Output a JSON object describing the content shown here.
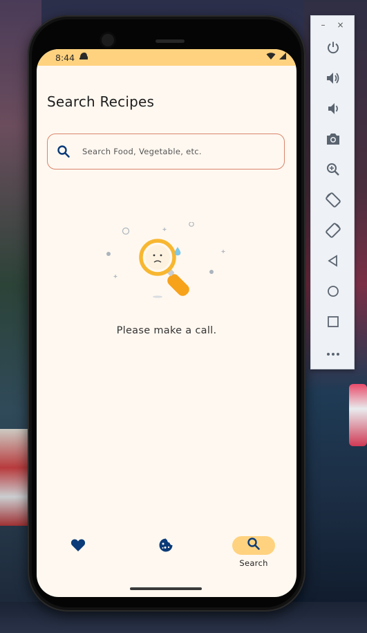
{
  "colors": {
    "accent": "#ffd27f",
    "screen_bg": "#fff8f0",
    "icon_blue": "#0b3b78",
    "search_border": "#d9836b",
    "illustration_orange": "#f7a21b"
  },
  "status_bar": {
    "time": "8:44",
    "notification_icon": "hat-icon",
    "wifi_icon": "wifi-icon",
    "signal_icon": "signal-icon"
  },
  "page": {
    "title": "Search Recipes"
  },
  "search": {
    "placeholder": "Search Food, Vegetable, etc.",
    "value": "",
    "icon": "search-icon"
  },
  "empty_state": {
    "illustration": "sad-magnifier-illustration",
    "message": "Please make a call."
  },
  "bottom_nav": {
    "items": [
      {
        "icon": "heart-icon",
        "label": "",
        "active": false
      },
      {
        "icon": "cookie-icon",
        "label": "",
        "active": false
      },
      {
        "icon": "search-icon",
        "label": "Search",
        "active": true
      }
    ]
  },
  "emulator_toolbar": {
    "minimize": "–",
    "close": "×",
    "buttons": [
      "power-icon",
      "volume-up-icon",
      "volume-down-icon",
      "camera-icon",
      "zoom-icon",
      "rotate-left-icon",
      "rotate-right-icon",
      "back-icon",
      "home-icon",
      "overview-icon",
      "more-icon"
    ]
  }
}
